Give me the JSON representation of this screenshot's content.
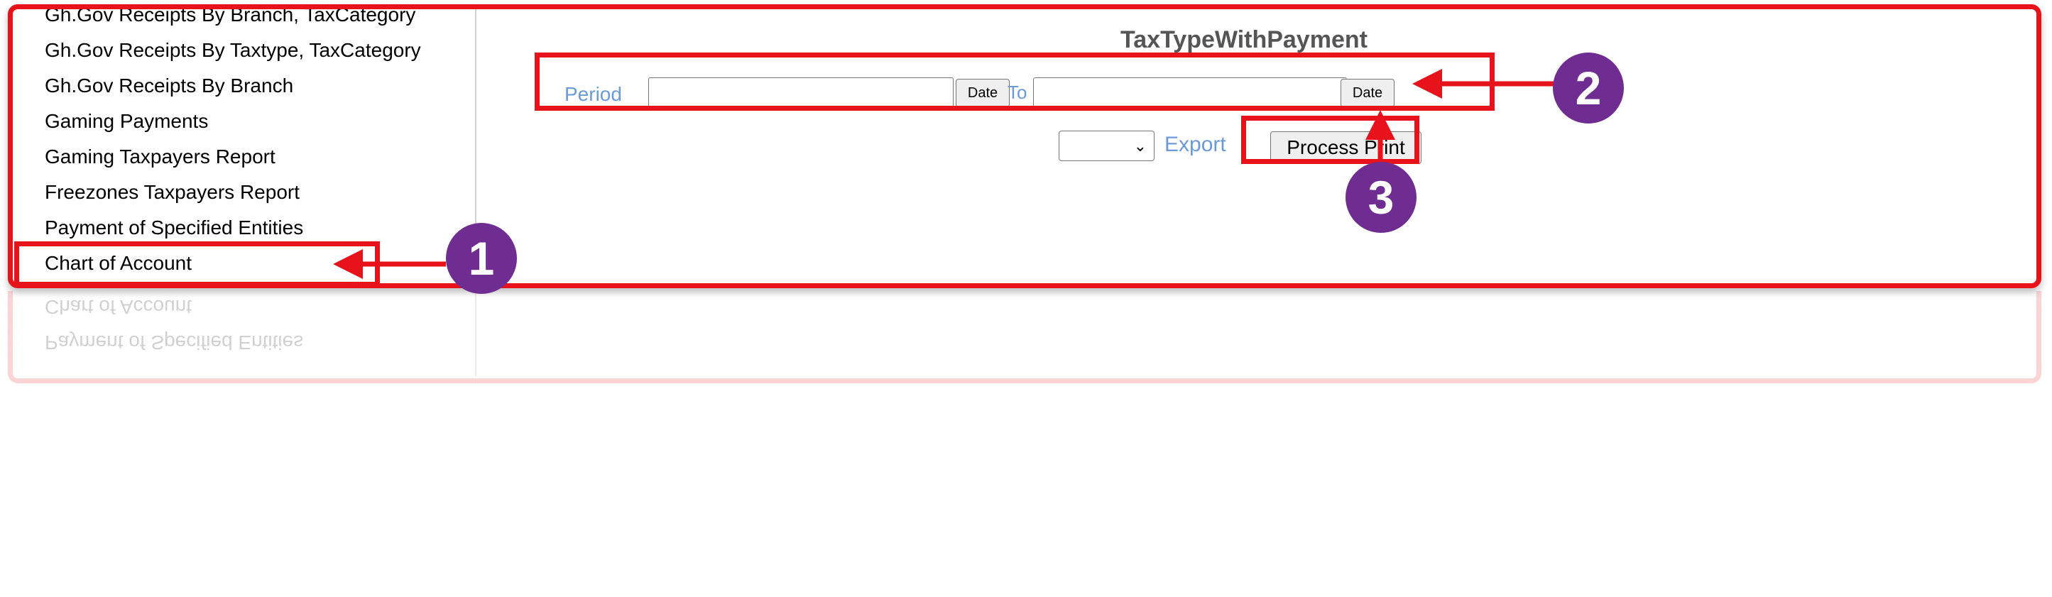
{
  "sidebar": {
    "items": [
      {
        "label": "Gh.Gov Receipts By Branch, TaxCategory"
      },
      {
        "label": "Gh.Gov Receipts By Taxtype, TaxCategory"
      },
      {
        "label": "Gh.Gov Receipts By Branch"
      },
      {
        "label": "Gaming Payments"
      },
      {
        "label": "Gaming Taxpayers Report"
      },
      {
        "label": "Freezones Taxpayers Report"
      },
      {
        "label": "Payment of Specified Entities"
      },
      {
        "label": "Chart of Account"
      }
    ]
  },
  "main": {
    "title": "TaxTypeWithPayment",
    "period_label": "Period",
    "to_label": "To",
    "from_date_value": "",
    "to_date_value": "",
    "date_button_label": "Date",
    "export_selected": "",
    "export_label": "Export",
    "process_button_label": "Process Print"
  },
  "annotations": {
    "badges": [
      "1",
      "2",
      "3"
    ],
    "highlight_color": "#e8121b",
    "badge_color": "#6f2c91"
  },
  "colors": {
    "link": "#6a9bd8",
    "title": "#555555"
  }
}
